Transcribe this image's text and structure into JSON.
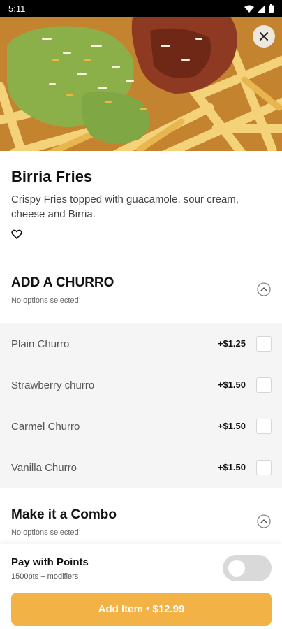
{
  "status_bar": {
    "time": "5:11"
  },
  "item": {
    "title": "Birria Fries",
    "description": "Crispy Fries topped with guacamole, sour cream, cheese and Birria."
  },
  "groups": [
    {
      "title": "ADD A CHURRO",
      "subtitle": "No options selected",
      "options": [
        {
          "name": "Plain Churro",
          "price": "+$1.25"
        },
        {
          "name": "Strawberry churro",
          "price": "+$1.50"
        },
        {
          "name": "Carmel Churro",
          "price": "+$1.50"
        },
        {
          "name": "Vanilla Churro",
          "price": "+$1.50"
        }
      ]
    },
    {
      "title": "Make it a Combo",
      "subtitle": "No options selected"
    }
  ],
  "points": {
    "title": "Pay with Points",
    "subtitle": "1500pts + modifiers",
    "enabled": false
  },
  "add_button": {
    "label": "Add Item • $12.99"
  },
  "colors": {
    "accent": "#f2b246",
    "options_bg": "#f5f5f5"
  }
}
